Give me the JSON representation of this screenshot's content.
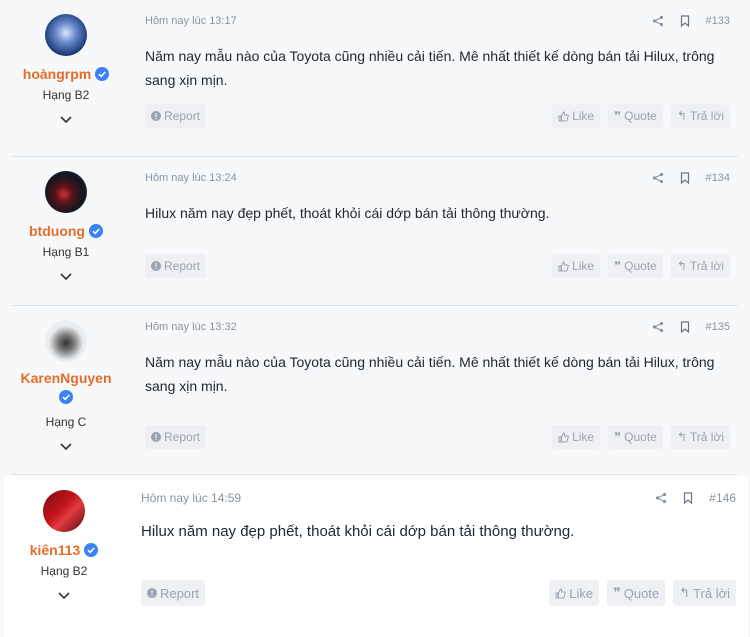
{
  "posts": [
    {
      "username": "hoàngrpm",
      "rank": "Hạng B2",
      "timestamp": "Hôm nay lúc 13:17",
      "post_number": "#133",
      "body": "Năm nay mẫu nào của Toyota cũng nhiều cải tiến. Mê nhất thiết kế dòng bán tải Hilux, trông sang xịn mịn.",
      "avatar_colors": [
        "#1b3a78",
        "#c8d8f2"
      ]
    },
    {
      "username": "btduong",
      "rank": "Hạng B1",
      "timestamp": "Hôm nay lúc 13:24",
      "post_number": "#134",
      "body": "Hilux năm nay đẹp phết, thoát khỏi cái dớp bán tải thông thường.",
      "avatar_colors": [
        "#121620",
        "#d1322f"
      ]
    },
    {
      "username": "KarenNguyen",
      "rank": "Hạng C",
      "timestamp": "Hôm nay lúc 13:32",
      "post_number": "#135",
      "body": "Năm nay mẫu nào của Toyota cũng nhiều cải tiến. Mê nhất thiết kế dòng bán tải Hilux, trông sang xịn mịn.",
      "avatar_colors": [
        "#e9ecef",
        "#333333"
      ]
    },
    {
      "username": "kiên113",
      "rank": "Hạng B2",
      "timestamp": "Hôm nay lúc 14:59",
      "post_number": "#146",
      "body": "Hilux năm nay đẹp phết, thoát khỏi cái dớp bán tải thông thường.",
      "avatar_colors": [
        "#c4161c",
        "#7a0a0e"
      ]
    }
  ],
  "actions": {
    "report": "Report",
    "like": "Like",
    "quote": "Quote",
    "reply": "Trả lời"
  },
  "colors": {
    "username": "#e46d2a",
    "verified": "#3b82f6",
    "meta": "#8a93a3",
    "button_bg": "#eef0f4"
  }
}
